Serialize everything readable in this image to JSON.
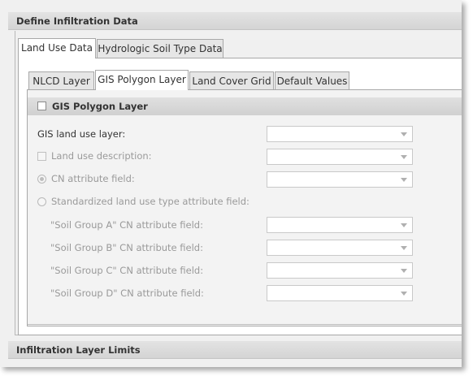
{
  "sections": {
    "infiltration_data_title": "Define Infiltration Data",
    "layer_limits_title": "Infiltration Layer Limits"
  },
  "outer_tabs": [
    {
      "label": "Land Use Data",
      "active": true
    },
    {
      "label": "Hydrologic Soil Type Data",
      "active": false
    }
  ],
  "inner_tabs": [
    {
      "label": "NLCD Layer",
      "active": false
    },
    {
      "label": "GIS Polygon Layer",
      "active": true
    },
    {
      "label": "Land Cover Grid",
      "active": false
    },
    {
      "label": "Default Values",
      "active": false
    }
  ],
  "gis_polygon": {
    "enable_label": "GIS Polygon Layer",
    "land_use_layer_label": "GIS land use layer:",
    "land_use_description_label": "Land use description:",
    "cn_attribute_label": "CN attribute field:",
    "standardized_label": "Standardized land use type attribute field:",
    "soil_group_a_label": "\"Soil Group A\" CN attribute field:",
    "soil_group_b_label": "\"Soil Group B\" CN attribute field:",
    "soil_group_c_label": "\"Soil Group C\" CN attribute field:",
    "soil_group_d_label": "\"Soil Group D\" CN attribute field:"
  },
  "icons": {
    "dropdown_arrow": "chevron-down-icon"
  }
}
